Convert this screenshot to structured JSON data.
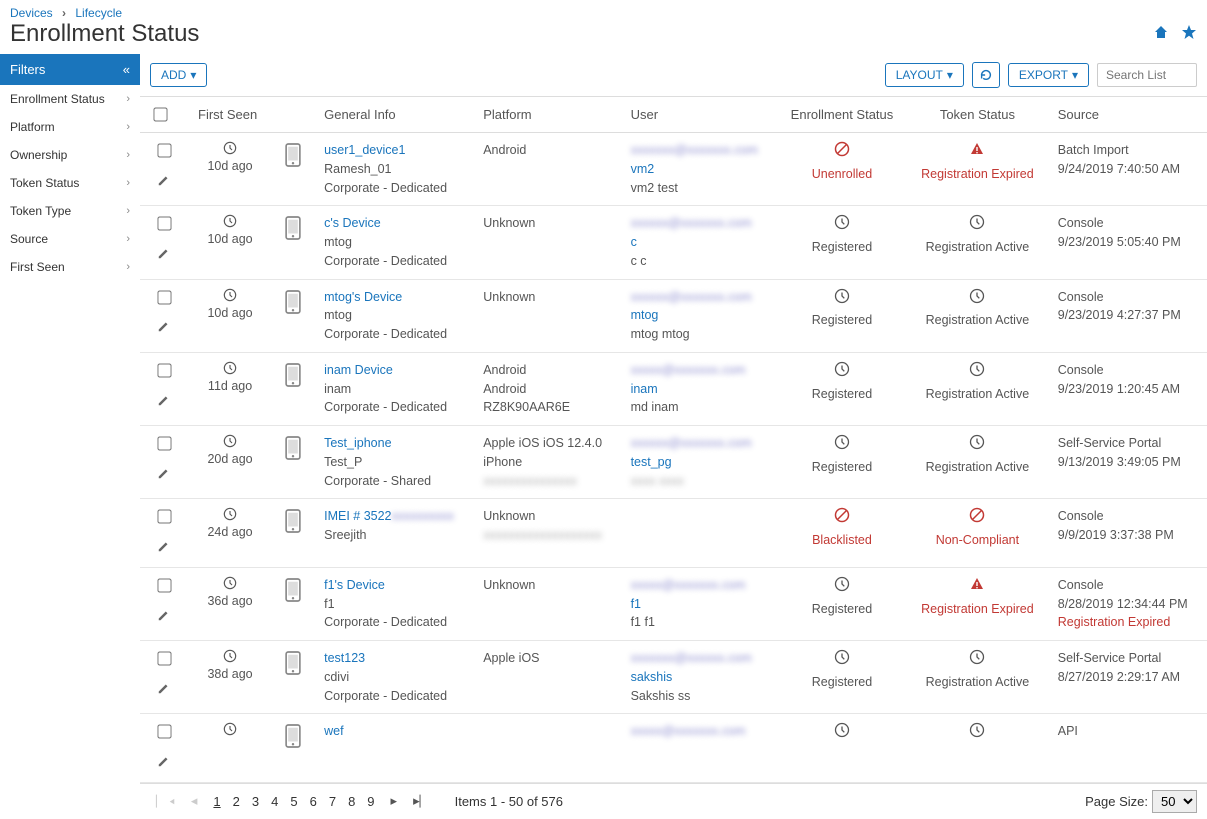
{
  "breadcrumb": {
    "a": "Devices",
    "b": "Lifecycle"
  },
  "page_title": "Enrollment Status",
  "sidebar": {
    "header": "Filters",
    "items": [
      "Enrollment Status",
      "Platform",
      "Ownership",
      "Token Status",
      "Token Type",
      "Source",
      "First Seen"
    ]
  },
  "toolbar": {
    "add": "ADD",
    "layout": "LAYOUT",
    "export": "EXPORT",
    "search_placeholder": "Search List"
  },
  "columns": {
    "first_seen": "First Seen",
    "general_info": "General Info",
    "platform": "Platform",
    "user": "User",
    "enroll_status": "Enrollment Status",
    "token_status": "Token Status",
    "source": "Source"
  },
  "rows": [
    {
      "first_seen": "10d ago",
      "device_name": "user1_device1",
      "device_line2": "Ramesh_01",
      "device_line3": "Corporate - Dedicated",
      "platform_line1": "Android",
      "platform_line2": "",
      "user_link_blur": "xxxxxxx@xxxxxxx.com",
      "user_link": "vm2",
      "user_line3": "vm2 test",
      "enroll_red": true,
      "enroll_icon": "ban",
      "enroll_text": "Unenrolled",
      "token_red": true,
      "token_icon": "warn",
      "token_text": "Registration Expired",
      "source_line1": "Batch Import",
      "source_line2": "9/24/2019 7:40:50 AM",
      "source_line3": ""
    },
    {
      "first_seen": "10d ago",
      "device_name": "c's Device",
      "device_line2": "mtog",
      "device_line3": "Corporate - Dedicated",
      "platform_line1": "Unknown",
      "platform_line2": "",
      "user_link_blur": "xxxxxx@xxxxxxx.com",
      "user_link": "c",
      "user_line3": "c c",
      "enroll_red": false,
      "enroll_icon": "clock",
      "enroll_text": "Registered",
      "token_red": false,
      "token_icon": "clock",
      "token_text": "Registration Active",
      "source_line1": "Console",
      "source_line2": "9/23/2019 5:05:40 PM",
      "source_line3": ""
    },
    {
      "first_seen": "10d ago",
      "device_name": "mtog's Device",
      "device_line2": "mtog",
      "device_line3": "Corporate - Dedicated",
      "platform_line1": "Unknown",
      "platform_line2": "",
      "user_link_blur": "xxxxxx@xxxxxxx.com",
      "user_link": "mtog",
      "user_line3": "mtog mtog",
      "enroll_red": false,
      "enroll_icon": "clock",
      "enroll_text": "Registered",
      "token_red": false,
      "token_icon": "clock",
      "token_text": "Registration Active",
      "source_line1": "Console",
      "source_line2": "9/23/2019 4:27:37 PM",
      "source_line3": ""
    },
    {
      "first_seen": "11d ago",
      "device_name": "inam Device",
      "device_line2": "inam",
      "device_line3": "Corporate - Dedicated",
      "platform_line1": "Android",
      "platform_line2": "Android",
      "platform_line3": "RZ8K90AAR6E",
      "user_link_blur": "xxxxx@xxxxxxx.com",
      "user_link": "inam",
      "user_line3": "md inam",
      "enroll_red": false,
      "enroll_icon": "clock",
      "enroll_text": "Registered",
      "token_red": false,
      "token_icon": "clock",
      "token_text": "Registration Active",
      "source_line1": "Console",
      "source_line2": "9/23/2019 1:20:45 AM",
      "source_line3": ""
    },
    {
      "first_seen": "20d ago",
      "device_name": "Test_iphone",
      "device_line2": "Test_P",
      "device_line3": "Corporate - Shared",
      "platform_line1": "Apple iOS iOS 12.4.0",
      "platform_line2": "iPhone",
      "platform_line3_blur": "xxxxxxxxxxxxxxx",
      "user_link_blur": "xxxxxx@xxxxxxx.com",
      "user_link": "test_pg",
      "user_line3_blur": "xxxx xxxx",
      "enroll_red": false,
      "enroll_icon": "clock",
      "enroll_text": "Registered",
      "token_red": false,
      "token_icon": "clock",
      "token_text": "Registration Active",
      "source_line1": "Self-Service Portal",
      "source_line2": "9/13/2019 3:49:05 PM",
      "source_line3": ""
    },
    {
      "first_seen": "24d ago",
      "device_name": "IMEI # 3522",
      "device_name_blur_suffix": "xxxxxxxxxx",
      "device_line2": "Sreejith",
      "device_line3": "",
      "platform_line1": "Unknown",
      "platform_line2_blur": "xxxxxxxxxxxxxxxxxxx",
      "user_link_blur": "",
      "user_link": "",
      "user_line3": "",
      "enroll_red": true,
      "enroll_icon": "ban",
      "enroll_text": "Blacklisted",
      "token_red": true,
      "token_icon": "ban",
      "token_text": "Non-Compliant",
      "source_line1": "Console",
      "source_line2": "9/9/2019 3:37:38 PM",
      "source_line3": ""
    },
    {
      "first_seen": "36d ago",
      "device_name": "f1's Device",
      "device_line2": "f1",
      "device_line3": "Corporate - Dedicated",
      "platform_line1": "Unknown",
      "platform_line2": "",
      "user_link_blur": "xxxxx@xxxxxxx.com",
      "user_link": "f1",
      "user_line3": "f1 f1",
      "enroll_red": false,
      "enroll_icon": "clock",
      "enroll_text": "Registered",
      "token_red": true,
      "token_icon": "warn",
      "token_text": "Registration Expired",
      "source_line1": "Console",
      "source_line2": "8/28/2019 12:34:44 PM",
      "source_line3": "Registration Expired",
      "source_line3_red": true
    },
    {
      "first_seen": "38d ago",
      "device_name": "test123",
      "device_line2": "cdivi",
      "device_line3": "Corporate - Dedicated",
      "platform_line1": "Apple iOS",
      "platform_line2": "",
      "user_link_blur": "xxxxxxx@xxxxxx.com",
      "user_link": "sakshis",
      "user_line3": "Sakshis ss",
      "enroll_red": false,
      "enroll_icon": "clock",
      "enroll_text": "Registered",
      "token_red": false,
      "token_icon": "clock",
      "token_text": "Registration Active",
      "source_line1": "Self-Service Portal",
      "source_line2": "8/27/2019 2:29:17 AM",
      "source_line3": ""
    },
    {
      "first_seen": "",
      "device_name": "wef",
      "device_line2": "",
      "device_line3": "",
      "platform_line1": "",
      "platform_line2": "",
      "user_link_blur": "xxxxx@xxxxxxx.com",
      "user_link": "",
      "user_line3": "",
      "enroll_red": false,
      "enroll_icon": "clock",
      "enroll_text": "",
      "token_red": false,
      "token_icon": "clock",
      "token_text": "",
      "source_line1": "API",
      "source_line2": "",
      "source_line3": ""
    }
  ],
  "footer": {
    "pages": [
      "1",
      "2",
      "3",
      "4",
      "5",
      "6",
      "7",
      "8",
      "9"
    ],
    "current_page": "1",
    "count_text": "Items 1 - 50 of 576",
    "page_size_label": "Page Size:",
    "page_size_value": "50"
  }
}
